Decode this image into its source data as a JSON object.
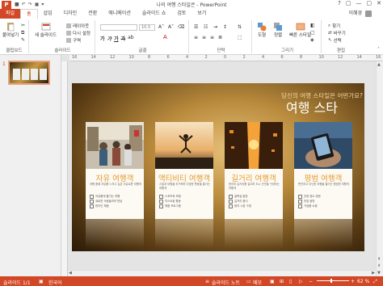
{
  "window": {
    "title": "나의 여행 스타일은 - PowerPoint",
    "controls": [
      "?",
      "▢",
      "—",
      "▢",
      "✕"
    ]
  },
  "tabs": [
    {
      "label": "파일"
    },
    {
      "label": "홈"
    },
    {
      "label": "삽입"
    },
    {
      "label": "디자인"
    },
    {
      "label": "전환"
    },
    {
      "label": "애니메이션"
    },
    {
      "label": "슬라이드 쇼"
    },
    {
      "label": "검토"
    },
    {
      "label": "보기"
    }
  ],
  "account": "이혜경",
  "ribbon": {
    "clipboard": {
      "paste": "붙여넣기",
      "label": "클립보드"
    },
    "slides": {
      "new_slide": "새 슬라이드",
      "layout": "레이아웃",
      "reset": "다시 설정",
      "section": "구역",
      "label": "슬라이드"
    },
    "font": {
      "size": "10.5",
      "label": "글꼴",
      "format": [
        "가",
        "가",
        "가",
        "가",
        "ab"
      ]
    },
    "paragraph": {
      "label": "단락"
    },
    "drawing": {
      "shapes": "도형",
      "arrange": "정렬",
      "quick_styles": "빠른 스타일",
      "label": "그리기"
    },
    "editing": {
      "find": "찾기",
      "replace": "바꾸기",
      "select": "선택",
      "label": "편집"
    }
  },
  "ruler": {
    "numbers": [
      "16",
      "14",
      "12",
      "10",
      "8",
      "6",
      "4",
      "2",
      "0",
      "2",
      "4",
      "6",
      "8",
      "10",
      "12",
      "14",
      "16"
    ]
  },
  "thumbnail": {
    "number": "1"
  },
  "slide": {
    "subtitle": "당신의 여행 스타일은 어떤가요?",
    "title": "여행 스타",
    "cards": [
      {
        "heading": "자유 여행객",
        "body": "여행 중에 자유를 느끼고 싶은 자유로운 여행객",
        "items": [
          "자유롭게 즐기는 여행",
          "새로운 사람들과의 만남",
          "현지인 체험"
        ]
      },
      {
        "heading": "액티비티 여행객",
        "body": "스릴과 모험을 추구하며 다양한 활동을 즐기는 여행객",
        "items": [
          "스포츠와 모험",
          "익스트림 활동",
          "체험 프로그램"
        ]
      },
      {
        "heading": "길거리 여행객",
        "body": "현지의 길거리를 걸으며 도시 곳곳을 구경하는 여행객",
        "items": [
          "골목길 탐방",
          "길거리 음식",
          "현지 시장 구경"
        ]
      },
      {
        "heading": "평범 여행객",
        "body": "편안하고 무난한 여행을 즐기는 평범한 여행객",
        "items": [
          "관광 명소 방문",
          "맛집 탐방",
          "기념품 쇼핑"
        ]
      }
    ]
  },
  "status": {
    "slide": "슬라이드 1/1",
    "language": "한국어",
    "notes": "슬라이드 노트",
    "comments": "메모",
    "zoom": "62 %"
  },
  "colors": {
    "accent": "#d24726",
    "card_heading": "#e39a2d"
  }
}
